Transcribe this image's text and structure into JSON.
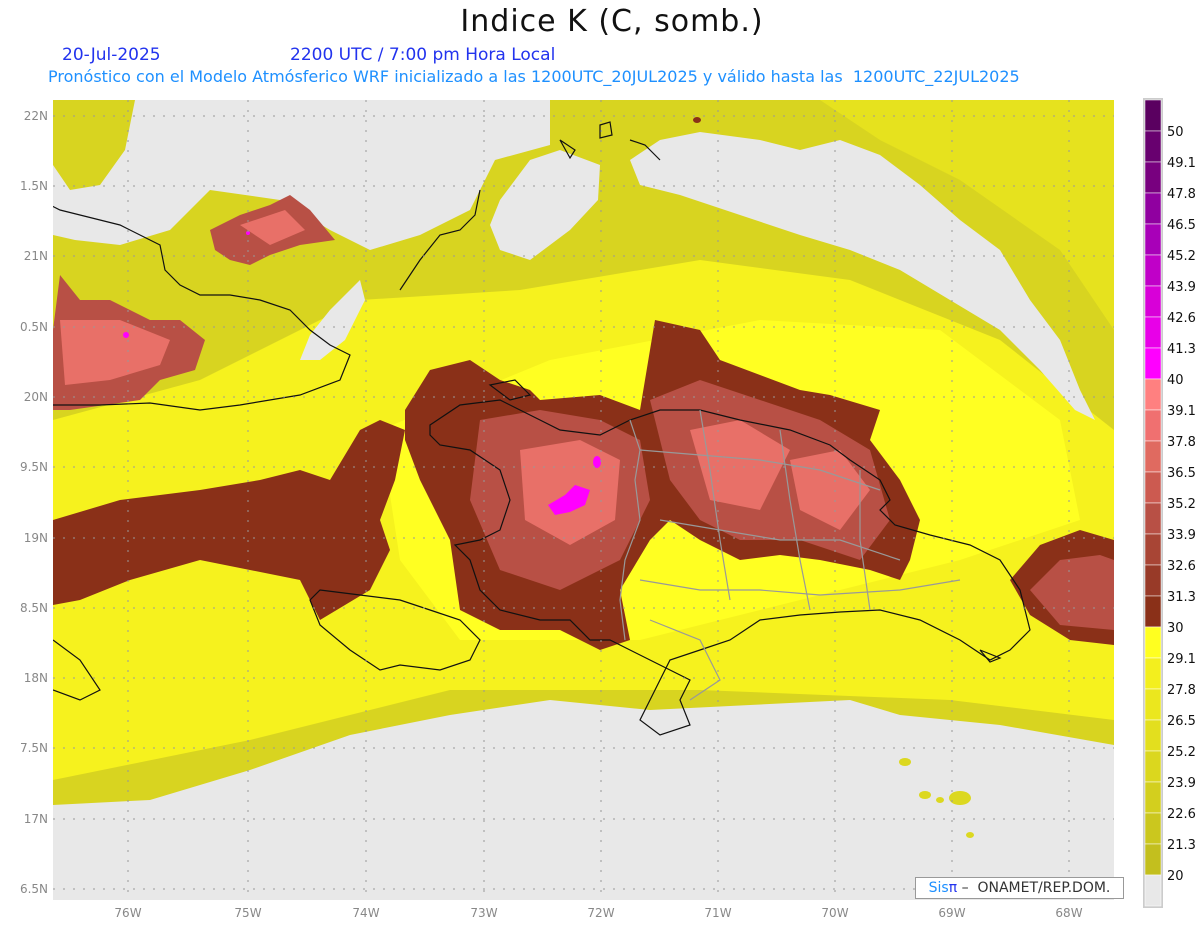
{
  "title": "Indice K (C, somb.)",
  "date": "20-Jul-2025",
  "time": "2200 UTC / 7:00 pm Hora Local",
  "subtitle": "Pronóstico con el Modelo Atmósferico WRF inicializado a las 1200UTC_20JUL2025 y válido hasta las  1200UTC_22JUL2025",
  "lat_labels": [
    "22N",
    "1.5N",
    "21N",
    "0.5N",
    "20N",
    "9.5N",
    "19N",
    "8.5N",
    "18N",
    "7.5N",
    "17N",
    "6.5N"
  ],
  "lon_labels": [
    "76W",
    "75W",
    "74W",
    "73W",
    "72W",
    "71W",
    "70W",
    "69W",
    "68W"
  ],
  "colorbar": {
    "labels": [
      "50",
      "49.1",
      "47.8",
      "46.5",
      "45.2",
      "43.9",
      "42.6",
      "41.3",
      "40",
      "39.1",
      "37.8",
      "36.5",
      "35.2",
      "33.9",
      "32.6",
      "31.3",
      "30",
      "29.1",
      "27.8",
      "26.5",
      "25.2",
      "23.9",
      "22.6",
      "21.3",
      "20"
    ],
    "colors": [
      "#5a0060",
      "#68006f",
      "#78007f",
      "#9000a0",
      "#a800b8",
      "#c000c8",
      "#d800d8",
      "#e800e8",
      "#ff00ff",
      "#ff8080",
      "#f07070",
      "#e06a60",
      "#cc5a50",
      "#b85045",
      "#a84535",
      "#983a28",
      "#8a3018",
      "#ffff20",
      "#f3ef1e",
      "#ebe71e",
      "#e3df1e",
      "#dbd71e",
      "#d3cf1e",
      "#cbc71e",
      "#c3bf1e",
      "#e8e8e8"
    ]
  },
  "logo": {
    "sis": "Sis",
    "pi": "π",
    "rest": " –  ONAMET/REP.DOM."
  }
}
